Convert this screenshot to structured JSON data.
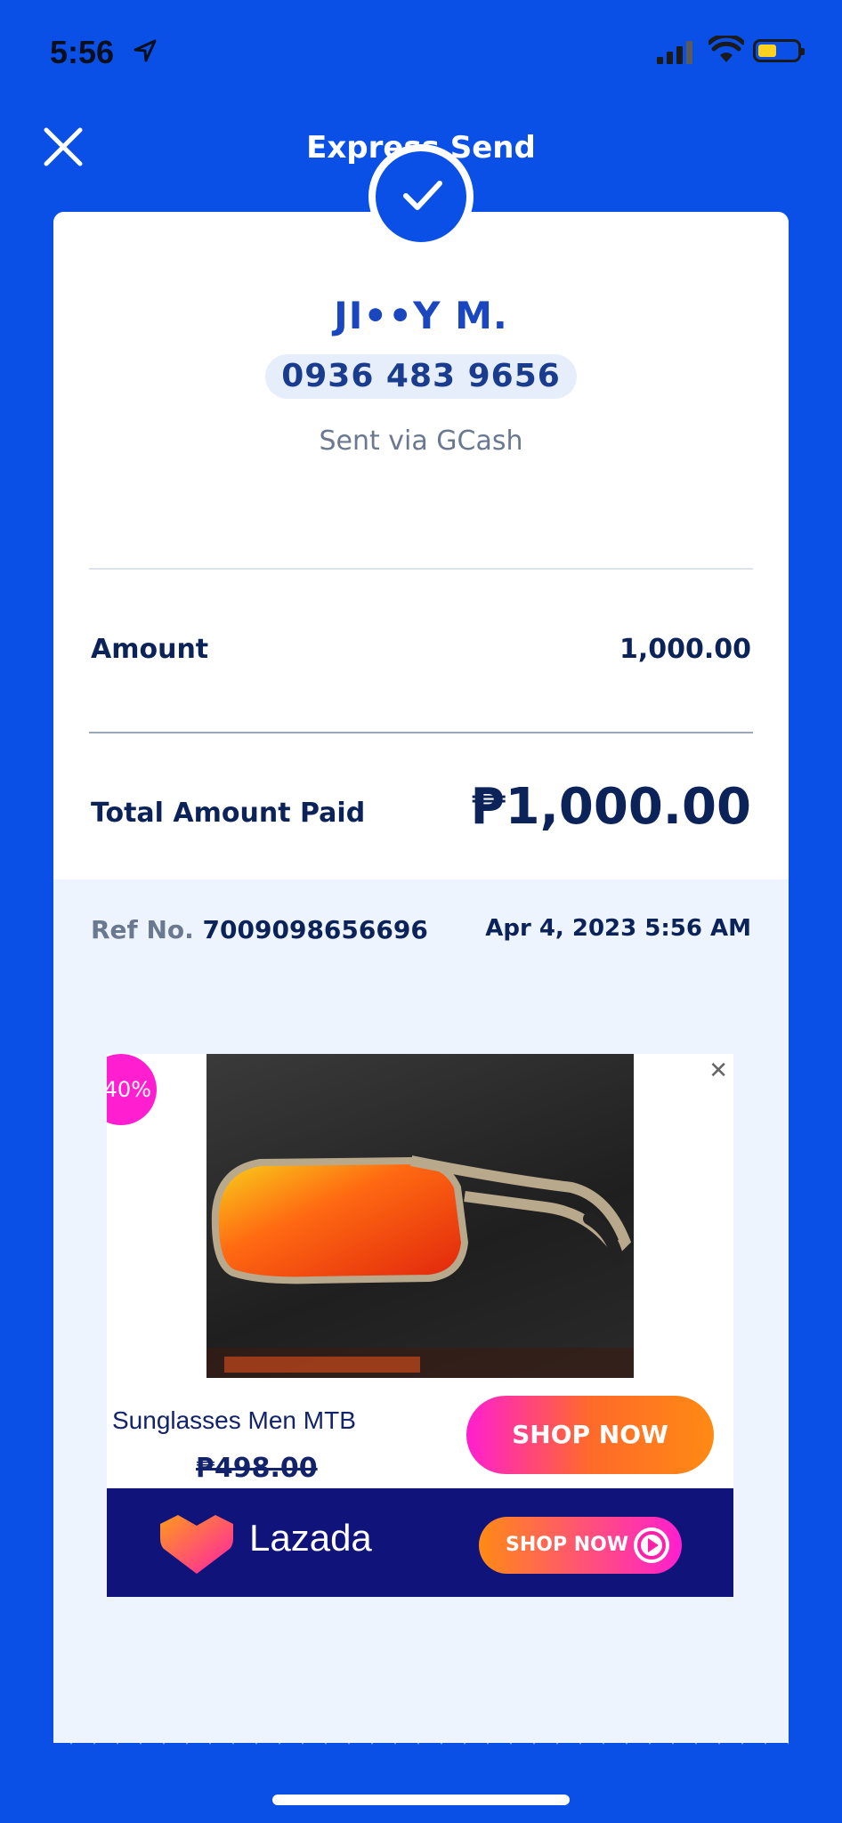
{
  "status_bar": {
    "time": "5:56"
  },
  "header": {
    "title": "Express Send"
  },
  "recipient": {
    "name": "JI••Y M.",
    "phone": "0936 483 9656",
    "via": "Sent via GCash"
  },
  "amount": {
    "label": "Amount",
    "value": "1,000.00"
  },
  "total": {
    "label": "Total Amount Paid",
    "value": "₱1,000.00"
  },
  "reference": {
    "label": "Ref No.",
    "number": "7009098656696",
    "date": "Apr 4, 2023 5:56 AM"
  },
  "ad": {
    "badge": "40%",
    "close": "✕",
    "product_name": "Sunglasses Men MTB",
    "price": "₱498.00",
    "shop_button": "SHOP NOW",
    "brand": "Lazada",
    "brand_button": "SHOP NOW"
  },
  "colors": {
    "brand_blue": "#0b50e6",
    "navy_text": "#0b2358",
    "lazada_navy": "#10137a"
  }
}
